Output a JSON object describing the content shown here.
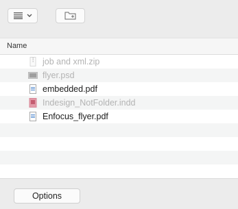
{
  "toolbar": {
    "view_button": {
      "icon": "list-view-icon",
      "menu_icon": "chevron-down-icon"
    },
    "new_folder_button": {
      "icon": "new-folder-icon"
    }
  },
  "table": {
    "column_header": "Name",
    "rows": [
      {
        "name": "job and xml.zip",
        "icon": "zip-file-icon",
        "enabled": false
      },
      {
        "name": "flyer.psd",
        "icon": "psd-file-icon",
        "enabled": false
      },
      {
        "name": "embedded.pdf",
        "icon": "pdf-file-icon",
        "enabled": true
      },
      {
        "name": "Indesign_NotFolder.indd",
        "icon": "indd-file-icon",
        "enabled": false
      },
      {
        "name": "Enfocus_flyer.pdf",
        "icon": "pdf-file-icon",
        "enabled": true
      }
    ]
  },
  "footer": {
    "options_label": "Options"
  }
}
